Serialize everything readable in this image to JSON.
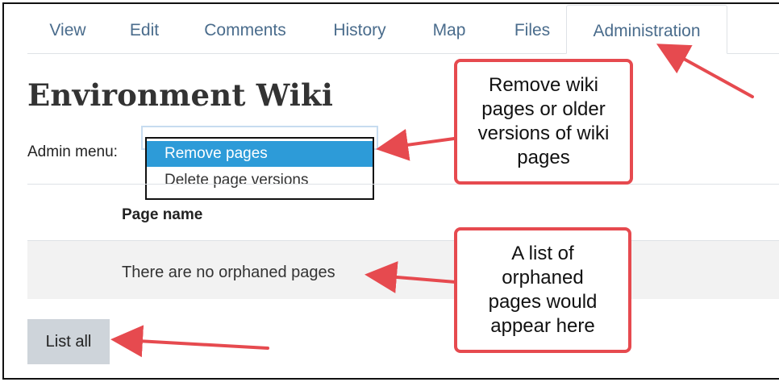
{
  "tabs": [
    {
      "label": "View",
      "active": false
    },
    {
      "label": "Edit",
      "active": false
    },
    {
      "label": "Comments",
      "active": false
    },
    {
      "label": "History",
      "active": false
    },
    {
      "label": "Map",
      "active": false
    },
    {
      "label": "Files",
      "active": false
    },
    {
      "label": "Administration",
      "active": true
    }
  ],
  "page_title": "Environment Wiki",
  "admin_menu": {
    "label": "Admin menu:",
    "options": [
      "Remove pages",
      "Delete page versions"
    ],
    "selected": "Remove pages"
  },
  "table": {
    "header": "Page name",
    "empty_message": "There are no orphaned pages"
  },
  "list_all_button": "List all",
  "callouts": {
    "admin": "Remove wiki\npages or older\nversions of wiki\npages",
    "orphaned": "A list of\norphaned\npages would\nappear here"
  },
  "colors": {
    "tab_text": "#4a6c8c",
    "selected_option": "#2d9bd8",
    "callout_border": "#e64a4f",
    "button_bg": "#ced4da"
  }
}
